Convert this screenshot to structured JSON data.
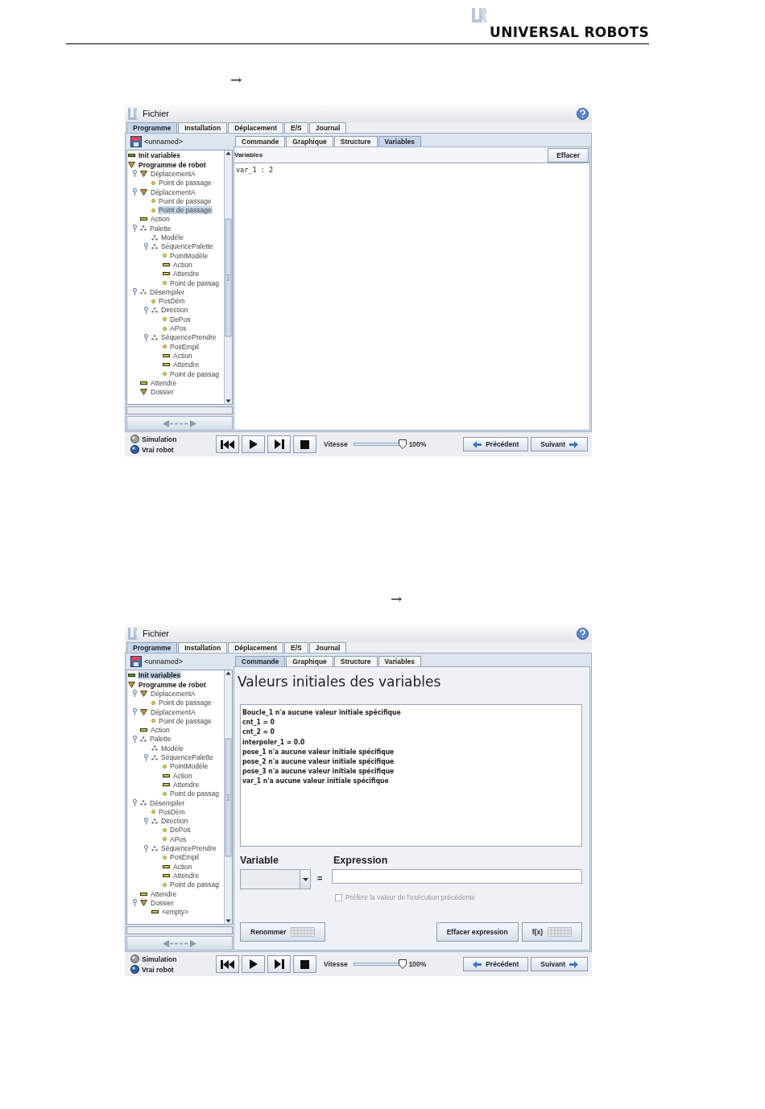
{
  "header": {
    "brand": "UNIVERSAL ROBOTS"
  },
  "sections": [
    {
      "arrow": "→",
      "screen": {
        "title": "Fichier",
        "tabs": [
          {
            "label": "Programme",
            "selected": true
          },
          {
            "label": "Installation",
            "selected": false
          },
          {
            "label": "Déplacement",
            "selected": false
          },
          {
            "label": "E/S",
            "selected": false
          },
          {
            "label": "Journal",
            "selected": false
          }
        ],
        "program_name": "<unnamed>",
        "tree": [
          {
            "label": "Init variables",
            "kind": "init",
            "selected": false
          },
          {
            "label": "Programme de robot",
            "kind": "folder",
            "selected": false,
            "children": [
              {
                "label": "DéplacementA",
                "kind": "folder",
                "selected": false,
                "children": [
                  {
                    "label": "Point de passage",
                    "kind": "waypoint",
                    "selected": false
                  }
                ]
              },
              {
                "label": "DéplacementA",
                "kind": "folder",
                "selected": false,
                "children": [
                  {
                    "label": "Point de passage",
                    "kind": "waypoint",
                    "selected": false
                  },
                  {
                    "label": "Point de passage",
                    "kind": "waypoint",
                    "selected": true
                  }
                ]
              },
              {
                "label": "Action",
                "kind": "action",
                "selected": false
              },
              {
                "label": "Palette",
                "kind": "pattern",
                "selected": false,
                "children": [
                  {
                    "label": "Modèle",
                    "kind": "pattern",
                    "selected": false
                  },
                  {
                    "label": "SéquencePalette",
                    "kind": "pattern",
                    "selected": false,
                    "children": [
                      {
                        "label": "PointModèle",
                        "kind": "waypoint",
                        "selected": false
                      },
                      {
                        "label": "Action",
                        "kind": "action",
                        "selected": false
                      },
                      {
                        "label": "Attendre",
                        "kind": "action",
                        "selected": false
                      },
                      {
                        "label": "Point de passag",
                        "kind": "waypoint",
                        "selected": false
                      }
                    ]
                  }
                ]
              },
              {
                "label": "Désempiler",
                "kind": "pattern",
                "selected": false,
                "children": [
                  {
                    "label": "PosDém",
                    "kind": "waypoint",
                    "selected": false
                  },
                  {
                    "label": "Direction",
                    "kind": "pattern",
                    "selected": false,
                    "children": [
                      {
                        "label": "DePos",
                        "kind": "waypoint",
                        "selected": false
                      },
                      {
                        "label": "APos",
                        "kind": "waypoint",
                        "selected": false
                      }
                    ]
                  },
                  {
                    "label": "SéquencePrendre",
                    "kind": "pattern",
                    "selected": false,
                    "children": [
                      {
                        "label": "PosEmpil",
                        "kind": "waypoint",
                        "selected": false
                      },
                      {
                        "label": "Action",
                        "kind": "action",
                        "selected": false
                      },
                      {
                        "label": "Attendre",
                        "kind": "action",
                        "selected": false
                      },
                      {
                        "label": "Point de passag",
                        "kind": "waypoint",
                        "selected": false
                      }
                    ]
                  }
                ]
              },
              {
                "label": "Attendre",
                "kind": "action",
                "selected": false
              },
              {
                "label": "Dossier",
                "kind": "folder",
                "selected": false
              }
            ]
          }
        ],
        "subtabs": [
          {
            "label": "Commande",
            "selected": false
          },
          {
            "label": "Graphique",
            "selected": false
          },
          {
            "label": "Structure",
            "selected": false
          },
          {
            "label": "Variables",
            "selected": true
          }
        ],
        "content": {
          "kind": "variables",
          "header": "Variables",
          "button": "Effacer",
          "rows": [
            "var_1 : 2"
          ]
        },
        "modes": [
          {
            "label": "Simulation",
            "selected": false
          },
          {
            "label": "Vrai robot",
            "selected": true
          }
        ],
        "speed": {
          "label": "Vitesse",
          "level": 1,
          "reading": "100%"
        },
        "previous": "Précédent",
        "next": "Suivant"
      }
    },
    {
      "arrow": "→",
      "screen": {
        "title": "Fichier",
        "tabs": [
          {
            "label": "Programme",
            "selected": true
          },
          {
            "label": "Installation",
            "selected": false
          },
          {
            "label": "Déplacement",
            "selected": false
          },
          {
            "label": "E/S",
            "selected": false
          },
          {
            "label": "Journal",
            "selected": false
          }
        ],
        "program_name": "<unnamed>",
        "tree": [
          {
            "label": "Init variables",
            "kind": "init",
            "selected": true
          },
          {
            "label": "Programme de robot",
            "kind": "folder",
            "selected": false,
            "children": [
              {
                "label": "DéplacementA",
                "kind": "folder",
                "selected": false,
                "children": [
                  {
                    "label": "Point de passage",
                    "kind": "waypoint",
                    "selected": false
                  }
                ]
              },
              {
                "label": "DéplacementA",
                "kind": "folder",
                "selected": false,
                "children": [
                  {
                    "label": "Point de passage",
                    "kind": "waypoint",
                    "selected": false
                  }
                ]
              },
              {
                "label": "Action",
                "kind": "action",
                "selected": false
              },
              {
                "label": "Palette",
                "kind": "pattern",
                "selected": false,
                "children": [
                  {
                    "label": "Modèle",
                    "kind": "pattern",
                    "selected": false
                  },
                  {
                    "label": "SéquencePalette",
                    "kind": "pattern",
                    "selected": false,
                    "children": [
                      {
                        "label": "PointModèle",
                        "kind": "waypoint",
                        "selected": false
                      },
                      {
                        "label": "Action",
                        "kind": "action",
                        "selected": false
                      },
                      {
                        "label": "Attendre",
                        "kind": "action",
                        "selected": false
                      },
                      {
                        "label": "Point de passag",
                        "kind": "waypoint",
                        "selected": false
                      }
                    ]
                  }
                ]
              },
              {
                "label": "Désempiler",
                "kind": "pattern",
                "selected": false,
                "children": [
                  {
                    "label": "PosDém",
                    "kind": "waypoint",
                    "selected": false
                  },
                  {
                    "label": "Direction",
                    "kind": "pattern",
                    "selected": false,
                    "children": [
                      {
                        "label": "DePos",
                        "kind": "waypoint",
                        "selected": false
                      },
                      {
                        "label": "APos",
                        "kind": "waypoint",
                        "selected": false
                      }
                    ]
                  },
                  {
                    "label": "SéquencePrendre",
                    "kind": "pattern",
                    "selected": false,
                    "children": [
                      {
                        "label": "PosEmpil",
                        "kind": "waypoint",
                        "selected": false
                      },
                      {
                        "label": "Action",
                        "kind": "action",
                        "selected": false
                      },
                      {
                        "label": "Attendre",
                        "kind": "action",
                        "selected": false
                      },
                      {
                        "label": "Point de passag",
                        "kind": "waypoint",
                        "selected": false
                      }
                    ]
                  }
                ]
              },
              {
                "label": "Attendre",
                "kind": "action",
                "selected": false
              },
              {
                "label": "Dossier",
                "kind": "folder",
                "selected": false,
                "children": [
                  {
                    "label": "<empty>",
                    "kind": "action",
                    "selected": false
                  }
                ]
              }
            ]
          }
        ],
        "subtabs": [
          {
            "label": "Commande",
            "selected": true
          },
          {
            "label": "Graphique",
            "selected": false
          },
          {
            "label": "Structure",
            "selected": false
          },
          {
            "label": "Variables",
            "selected": false
          }
        ],
        "content": {
          "kind": "init",
          "heading": "Valeurs initiales des variables",
          "lines": [
            "Boucle_1 n'a aucune valeur initiale spécifique",
            "cnt_1 = 0",
            "cnt_2 = 0",
            "interpoler_1 = 0.0",
            "pose_1 n'a aucune valeur initiale spécifique",
            "pose_2 n'a aucune valeur initiale spécifique",
            "pose_3 n'a aucune valeur initiale spécifique",
            "var_1 n'a aucune valeur initiale spécifique"
          ],
          "variable_label": "Variable",
          "equals": "=",
          "expression_label": "Expression",
          "checkbox": {
            "label": "Préfère la valeur de l'exécution précédente",
            "checked": false,
            "disabled": true
          },
          "buttons": [
            {
              "label": "Renommer",
              "keyboard": true
            },
            {
              "label": "Effacer expression",
              "keyboard": false
            },
            {
              "label": "f(x)",
              "keyboard": true
            }
          ]
        },
        "modes": [
          {
            "label": "Simulation",
            "selected": false
          },
          {
            "label": "Vrai robot",
            "selected": true
          }
        ],
        "speed": {
          "label": "Vitesse",
          "level": 1,
          "reading": "100%"
        },
        "previous": "Précédent",
        "next": "Suivant"
      }
    }
  ]
}
